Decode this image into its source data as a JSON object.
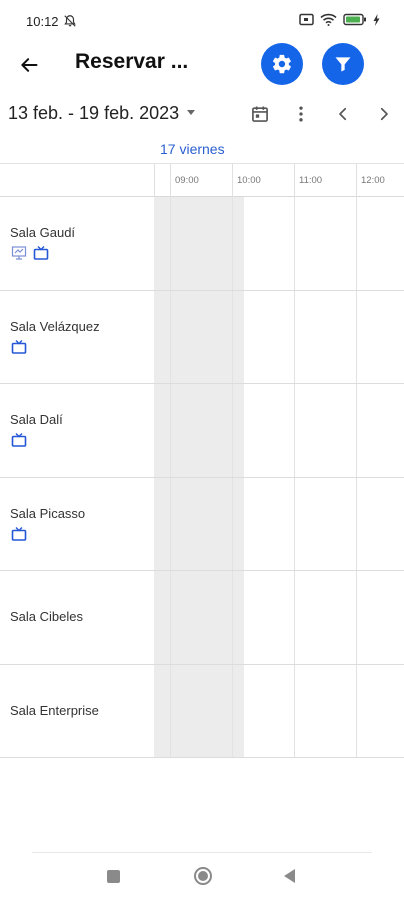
{
  "status_bar": {
    "time": "10:12",
    "icons": [
      "bell-off-icon",
      "screen-icon",
      "wifi-icon",
      "battery-icon",
      "charging-icon"
    ]
  },
  "app_bar": {
    "title": "Reservar ...",
    "back_icon": "arrow-left-icon",
    "settings_icon": "gear-icon",
    "filter_icon": "filter-icon",
    "accent_color": "#1565e8"
  },
  "toolbar": {
    "date_range": "13 feb. - 19 feb. 2023",
    "icons": [
      "calendar-icon",
      "more-vertical-icon",
      "chevron-left-icon",
      "chevron-right-icon"
    ]
  },
  "schedule": {
    "day_label": "17 viernes",
    "day_color": "#2a5fd0",
    "hours": [
      "09:00",
      "10:00",
      "11:00",
      "12:00"
    ],
    "rooms": [
      {
        "name": "Sala Gaudí",
        "icons": [
          "presentation-icon",
          "tv-icon"
        ]
      },
      {
        "name": "Sala Velázquez",
        "icons": [
          "tv-icon"
        ]
      },
      {
        "name": "Sala Dalí",
        "icons": [
          "tv-icon"
        ]
      },
      {
        "name": "Sala Picasso",
        "icons": [
          "tv-icon"
        ]
      },
      {
        "name": "Sala Cibeles",
        "icons": []
      },
      {
        "name": "Sala Enterprise",
        "icons": []
      }
    ]
  },
  "nav_bar": {
    "icons": [
      "recents-icon",
      "home-icon",
      "back-icon"
    ]
  }
}
